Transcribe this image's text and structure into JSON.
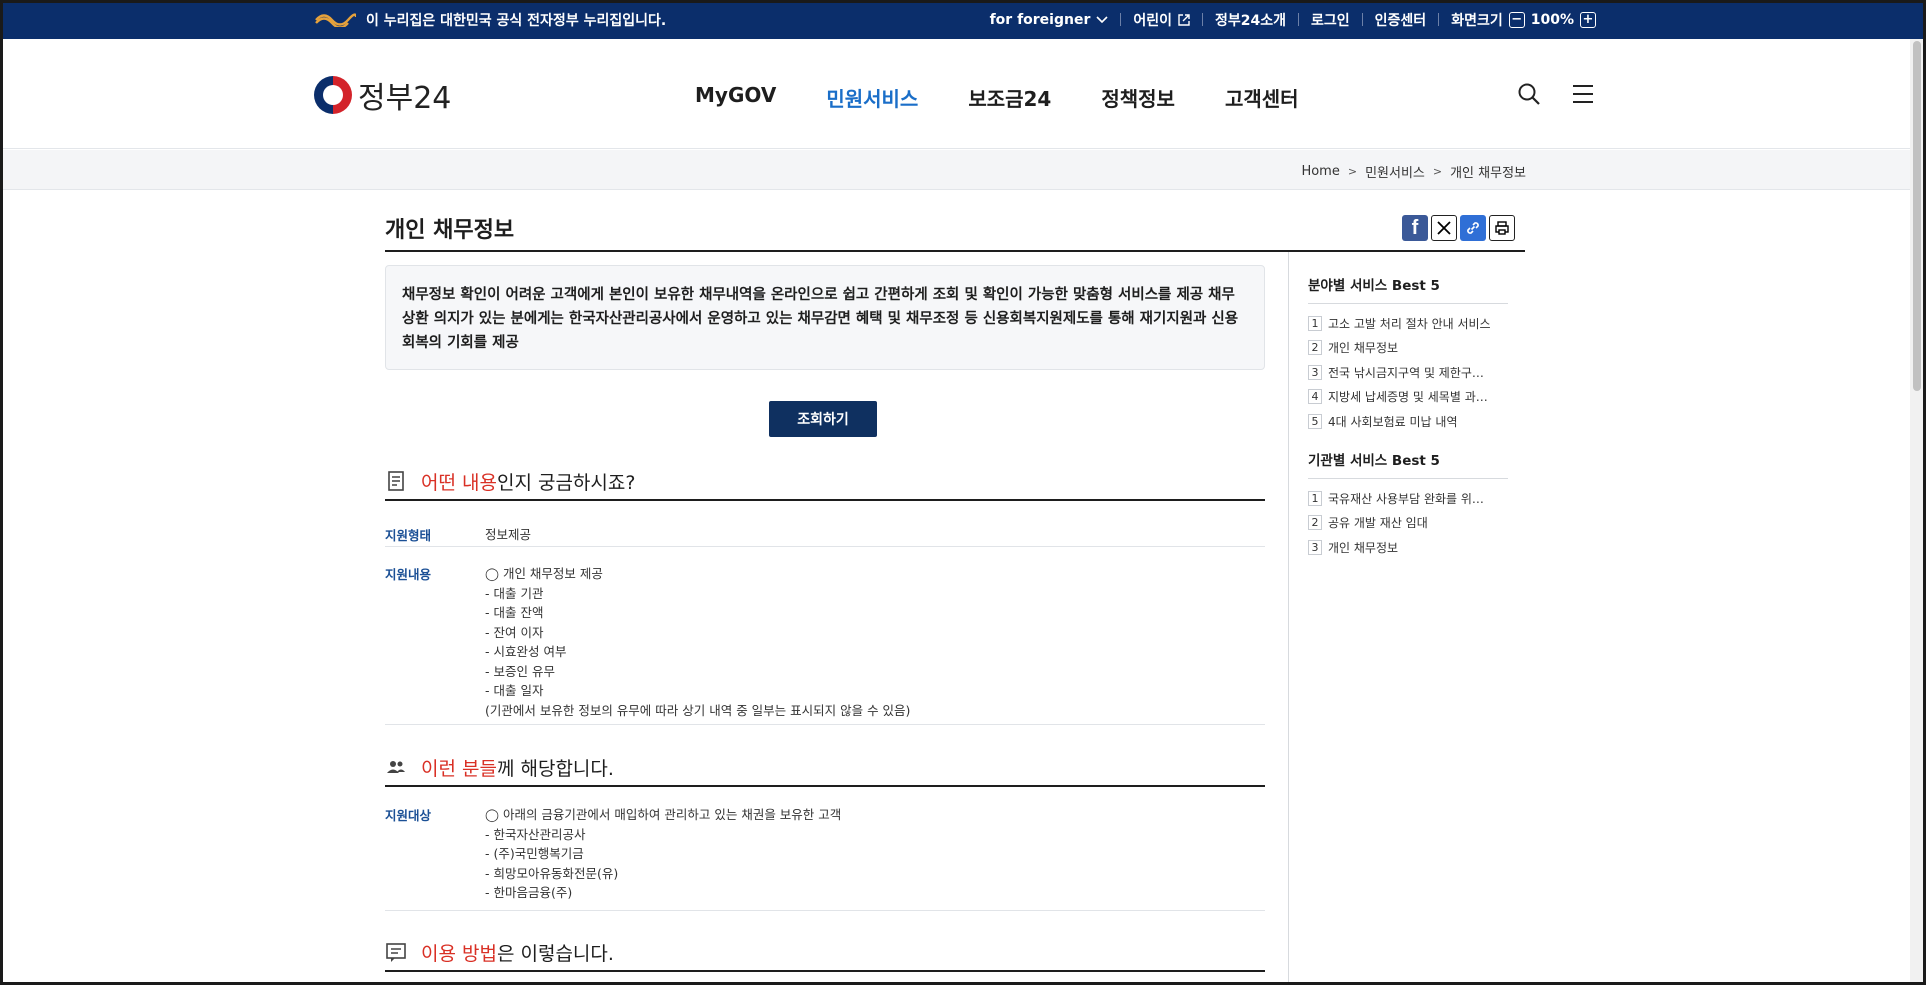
{
  "gov_bar": {
    "notice": "이 누리집은 대한민국 공식 전자정부 누리집입니다.",
    "links": [
      {
        "label": "for foreigner",
        "icon": "chevron-down-icon"
      },
      {
        "label": "어린이",
        "icon": "external-link-icon"
      },
      {
        "label": "정부24소개"
      },
      {
        "label": "로그인"
      },
      {
        "label": "인증센터"
      }
    ],
    "zoom_label": "화면크기",
    "zoom_value": "100%",
    "zoom_minus": "−",
    "zoom_plus": "+"
  },
  "header": {
    "logo_text": "정부24",
    "nav": [
      "MyGOV",
      "민원서비스",
      "보조금24",
      "정책정보",
      "고객센터"
    ],
    "active_nav": "민원서비스",
    "icons": [
      "search-icon",
      "menu-icon"
    ]
  },
  "breadcrumb": [
    "Home",
    "민원서비스",
    "개인 채무정보"
  ],
  "page": {
    "title": "개인 채무정보",
    "share_icons": [
      "facebook-icon",
      "x-icon",
      "link-icon",
      "print-icon"
    ],
    "summary": "채무정보 확인이 어려운 고객에게 본인이 보유한 채무내역을 온라인으로 쉽고 간편하게 조회 및 확인이 가능한 맞춤형 서비스를 제공 채무상환 의지가 있는 분에게는 한국자산관리공사에서 운영하고 있는 채무감면 혜택 및 채무조정 등 신용회복지원제도를 통해 재기지원과 신용회복의 기회를 제공",
    "query_button": "조회하기"
  },
  "sections": {
    "what": {
      "highlight": "어떤 내용",
      "rest": "인지 궁금하시죠?"
    },
    "who": {
      "highlight": "이런 분들",
      "rest": "께 해당합니다."
    },
    "how": {
      "highlight": "이용 방법",
      "rest": "은 이렇습니다."
    }
  },
  "details": {
    "support_type_label": "지원형태",
    "support_type_value": "정보제공",
    "support_content_label": "지원내용",
    "support_content_lines": [
      "◯ 개인 채무정보 제공",
      "- 대출 기관",
      "- 대출 잔액",
      "- 잔여 이자",
      "- 시효완성 여부",
      "- 보증인 유무",
      "- 대출 일자",
      "(기관에서 보유한 정보의 유무에 따라 상기 내역 중 일부는 표시되지 않을 수 있음)"
    ],
    "target_label": "지원대상",
    "target_lines": [
      "◯ 아래의 금융기관에서 매입하여 관리하고 있는 채권을 보유한 고객",
      "- 한국자산관리공사",
      "- (주)국민행복기금",
      "- 희망모아유동화전문(유)",
      "- 한마음금융(주)"
    ]
  },
  "aside": {
    "field_title": "분야별 서비스 Best 5",
    "field_items": [
      "고소 고발 처리 절차 안내 서비스",
      "개인 채무정보",
      "전국 낚시금지구역 및 제한구…",
      "지방세 납세증명 및 세목별 과…",
      "4대 사회보험료 미납 내역"
    ],
    "org_title": "기관별 서비스 Best 5",
    "org_items": [
      "국유재산 사용부담 완화를 위…",
      "공유 개발 재산 임대",
      "개인 채무정보"
    ]
  },
  "colors": {
    "gov_bar": "#0b2e6b",
    "active_nav": "#1a6ec8",
    "highlight": "#d93025",
    "label": "#1a4f95",
    "button": "#0f3060"
  }
}
